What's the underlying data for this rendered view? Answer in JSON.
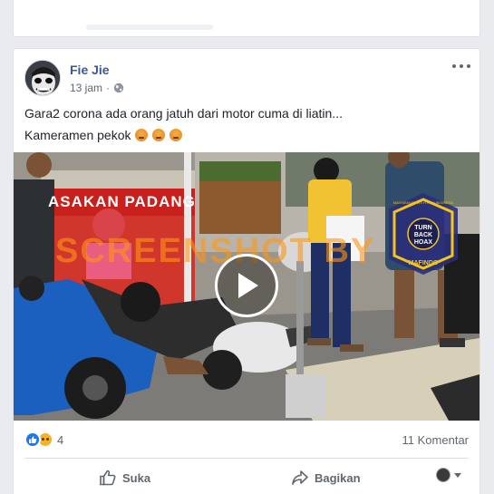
{
  "post": {
    "author": "Fie Jie",
    "time": "13 jam",
    "separator": "·",
    "text_line1": "Gara2 corona ada orang jatuh dari motor cuma di liatin...",
    "text_line2": "Kameramen pekok",
    "text_line2_emoji": [
      "angry-face",
      "angry-face",
      "angry-face"
    ]
  },
  "video": {
    "watermark": "SCREENSHOT BY",
    "shop_sign": "ASAKAN PADANG",
    "badge_top": "TURN BACK HOAX",
    "badge_ring": "MASYARAKAT ANTI FITNAH INDONESIA",
    "badge_bottom": "MAFINDO"
  },
  "stats": {
    "reaction_icons": [
      "like-icon",
      "sad-icon"
    ],
    "reaction_count": "4",
    "comments": "11 Komentar"
  },
  "actions": {
    "like_label": "Suka",
    "share_label": "Bagikan"
  },
  "colors": {
    "author": "#385898",
    "like_blue": "#1877f2",
    "text_grey": "#606770"
  }
}
